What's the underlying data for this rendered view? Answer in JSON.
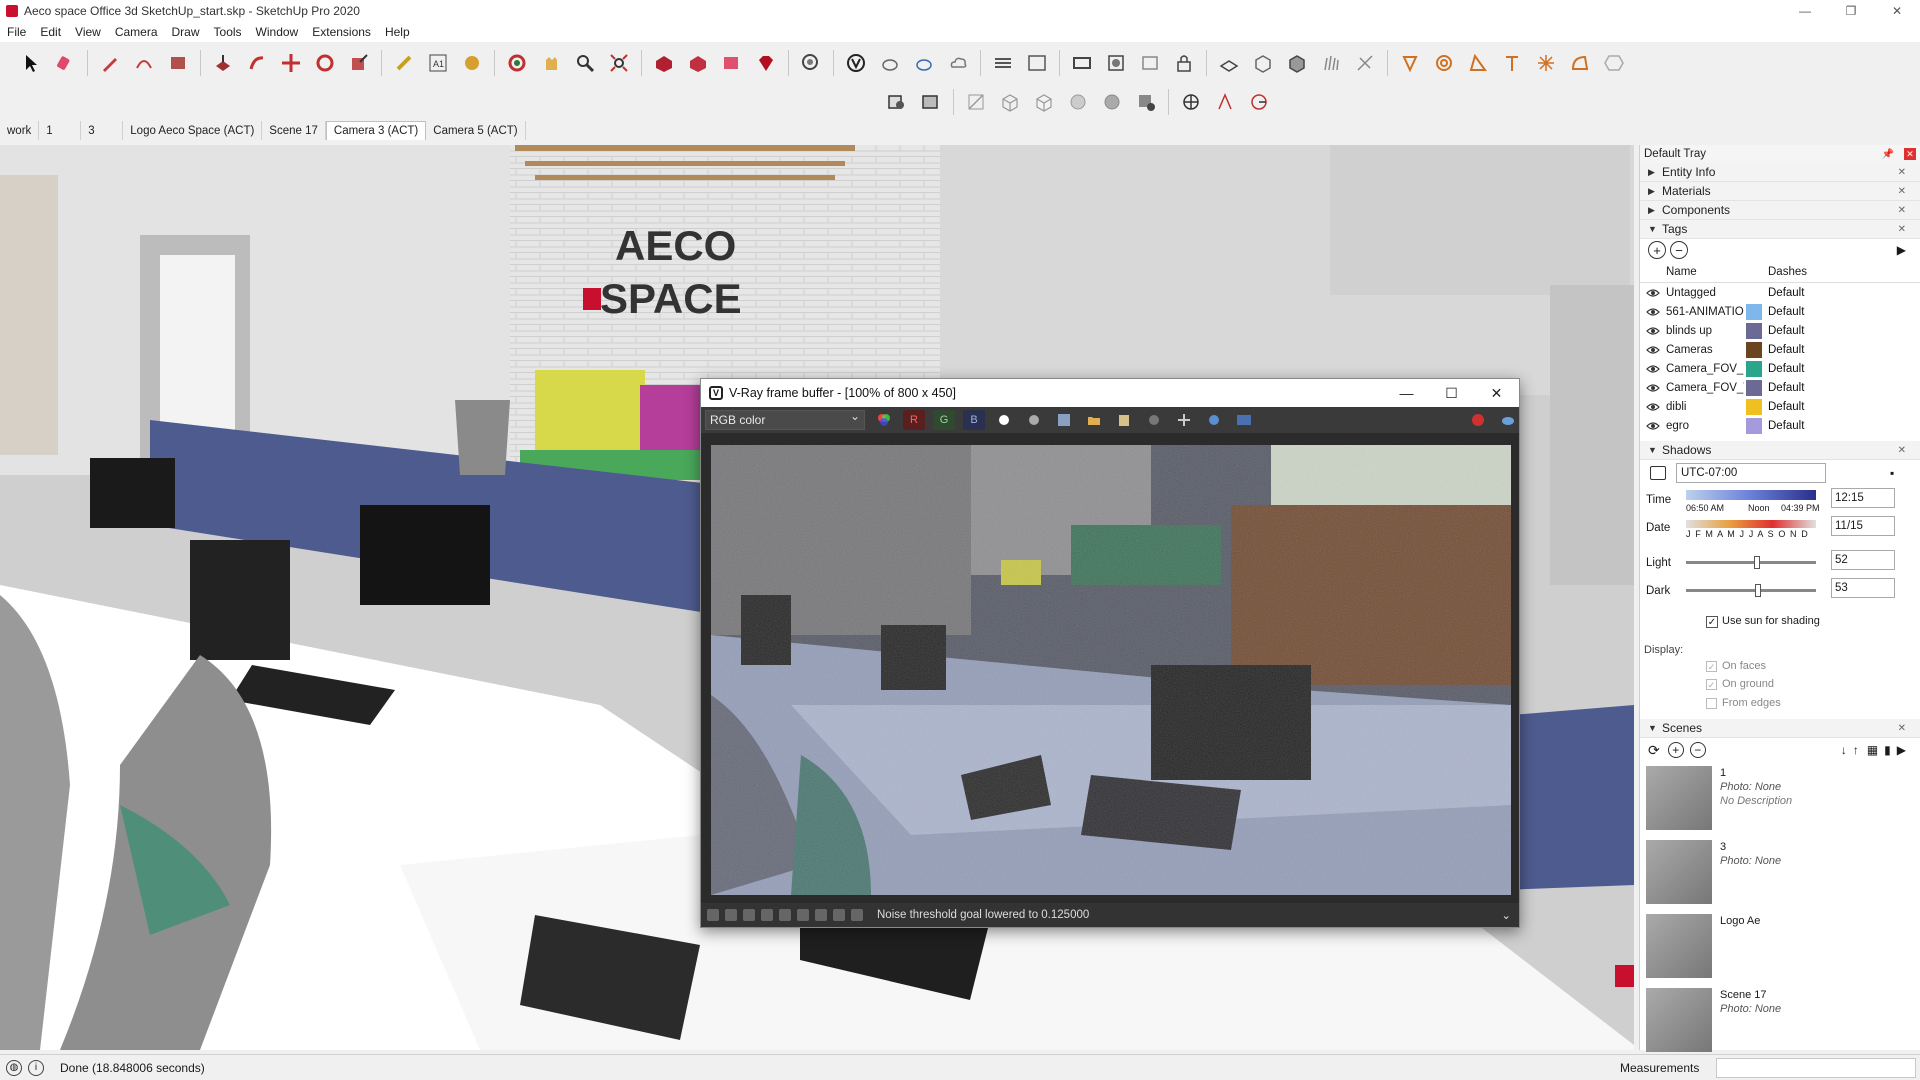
{
  "window": {
    "title": "Aeco space Office 3d SketchUp_start.skp - SketchUp Pro 2020",
    "controls": [
      "—",
      "❐",
      "✕"
    ]
  },
  "menu": [
    "File",
    "Edit",
    "View",
    "Camera",
    "Draw",
    "Tools",
    "Window",
    "Extensions",
    "Help"
  ],
  "scene_tabs": [
    "work",
    "1",
    "3",
    "Logo Aeco Space (ACT)",
    "Scene 17",
    "Camera 3 (ACT)",
    "Camera 5 (ACT)"
  ],
  "active_scene_tab": "Camera 3 (ACT)",
  "vray": {
    "title": "V-Ray frame buffer - [100% of 800 x 450]",
    "channel": "RGB color",
    "channel_buttons": [
      "R",
      "G",
      "B"
    ],
    "status": "Noise threshold goal lowered to 0.125000",
    "logo": "V"
  },
  "tray": {
    "title": "Default Tray",
    "sections": {
      "entity_info": "Entity Info",
      "materials": "Materials",
      "components": "Components",
      "tags": "Tags",
      "shadows": "Shadows",
      "scenes": "Scenes"
    },
    "tags_columns": {
      "name": "Name",
      "dashes": "Dashes"
    },
    "tags": [
      {
        "name": "Untagged",
        "color": "",
        "dashes": "Default"
      },
      {
        "name": "561-ANIMATIO",
        "color": "#7fb7ec",
        "dashes": "Default"
      },
      {
        "name": "blinds up",
        "color": "#6a6a94",
        "dashes": "Default"
      },
      {
        "name": "Cameras",
        "color": "#6b4420",
        "dashes": "Default"
      },
      {
        "name": "Camera_FOV_L",
        "color": "#2aa58a",
        "dashes": "Default"
      },
      {
        "name": "Camera_FOV_V",
        "color": "#6a6a94",
        "dashes": "Default"
      },
      {
        "name": "dibli",
        "color": "#f0c020",
        "dashes": "Default"
      },
      {
        "name": "egro",
        "color": "#a49adc",
        "dashes": "Default"
      }
    ],
    "shadows": {
      "timezone": "UTC-07:00",
      "time_label": "Time",
      "date_label": "Date",
      "time_marks": [
        "06:50 AM",
        "Noon",
        "04:39 PM"
      ],
      "months": "J F M A M J J A S O N D",
      "time_value": "12:15",
      "date_value": "11/15",
      "light_label": "Light",
      "light_value": "52",
      "dark_label": "Dark",
      "dark_value": "53",
      "use_sun": "Use sun for shading",
      "display_label": "Display:",
      "on_faces": "On faces",
      "on_ground": "On ground",
      "from_edges": "From edges"
    },
    "scenes": [
      {
        "name": "1",
        "photo": "Photo: None",
        "desc": "No Description"
      },
      {
        "name": "3",
        "photo": "Photo: None",
        "desc": ""
      },
      {
        "name": "Logo Ae",
        "photo": "",
        "desc": ""
      },
      {
        "name": "Scene 17",
        "photo": "Photo: None",
        "desc": ""
      }
    ]
  },
  "status": {
    "message": "Done (18.848006 seconds)",
    "measurements_label": "Measurements",
    "info_icon": "i"
  },
  "scene_text": {
    "logo_line1": "AECO",
    "logo_line2": "SPACE"
  }
}
